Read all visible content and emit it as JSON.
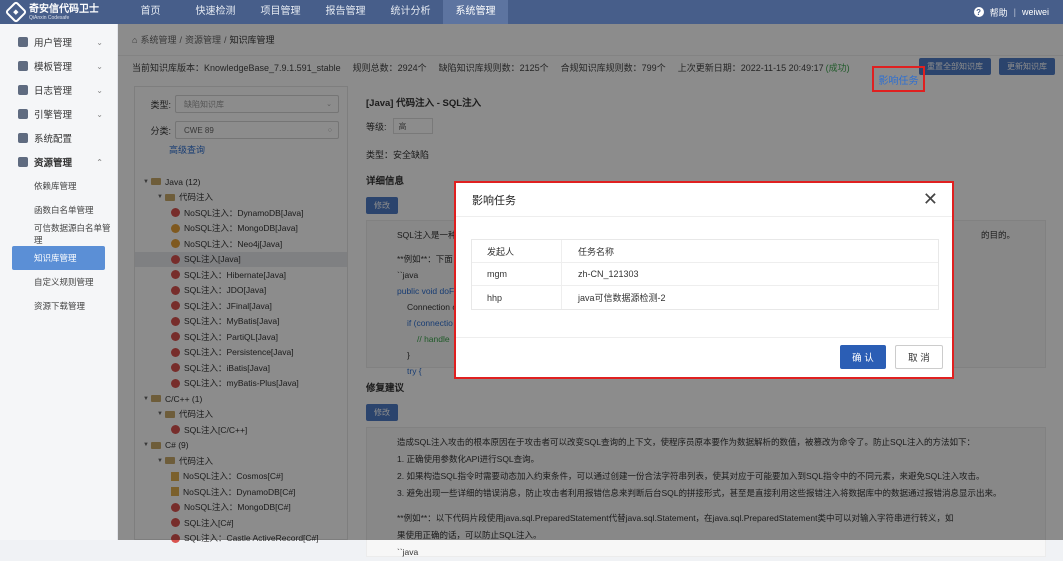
{
  "app": {
    "name": "奇安信代码卫士",
    "sub": "QiAnxin Codesafe"
  },
  "nav": [
    "首页",
    "快速检测",
    "项目管理",
    "报告管理",
    "统计分析",
    "系统管理"
  ],
  "nav_active": 5,
  "top_right": {
    "help": "帮助",
    "sep": "|",
    "user": "weiwei"
  },
  "sidebar": {
    "groups": [
      "用户管理",
      "模板管理",
      "日志管理",
      "引擎管理",
      "系统配置",
      "资源管理"
    ],
    "subs": [
      "依赖库管理",
      "函数白名单管理",
      "可信数据源白名单管理",
      "知识库管理",
      "自定义规则管理",
      "资源下载管理"
    ],
    "active_sub": 3
  },
  "breadcrumb": [
    "系统管理",
    "/",
    "资源管理",
    "/",
    "知识库管理"
  ],
  "info": {
    "version": "当前知识库版本：KnowledgeBase_7.9.1.591_stable",
    "total": "规则总数：2924个",
    "defect": "缺陷知识库规则数：2125个",
    "compliance": "合规知识库规则数：799个",
    "updated": "上次更新日期：2022-11-15 20:49:17",
    "status": "(成功)"
  },
  "buttons": {
    "reset": "重置全部知识库",
    "update": "更新知识库"
  },
  "filter": {
    "type_label": "类型:",
    "type_value": "缺陷知识库",
    "class_label": "分类:",
    "class_value": "CWE 89",
    "advanced": "高级查询"
  },
  "tree": [
    {
      "label": "Java (12)",
      "level": 0,
      "kind": "folder"
    },
    {
      "label": "代码注入",
      "level": 1,
      "kind": "folder"
    },
    {
      "label": "NoSQL注入：DynamoDB[Java]",
      "level": 2,
      "kind": "bad"
    },
    {
      "label": "NoSQL注入：MongoDB[Java]",
      "level": 2,
      "kind": "warn"
    },
    {
      "label": "NoSQL注入：Neo4j[Java]",
      "level": 2,
      "kind": "warn"
    },
    {
      "label": "SQL注入[Java]",
      "level": 2,
      "kind": "bad",
      "sel": true
    },
    {
      "label": "SQL注入：Hibernate[Java]",
      "level": 2,
      "kind": "bad"
    },
    {
      "label": "SQL注入：JDO[Java]",
      "level": 2,
      "kind": "bad"
    },
    {
      "label": "SQL注入：JFinal[Java]",
      "level": 2,
      "kind": "bad"
    },
    {
      "label": "SQL注入：MyBatis[Java]",
      "level": 2,
      "kind": "bad"
    },
    {
      "label": "SQL注入：PartiQL[Java]",
      "level": 2,
      "kind": "bad"
    },
    {
      "label": "SQL注入：Persistence[Java]",
      "level": 2,
      "kind": "bad"
    },
    {
      "label": "SQL注入：iBatis[Java]",
      "level": 2,
      "kind": "bad"
    },
    {
      "label": "SQL注入：myBatis-Plus[Java]",
      "level": 2,
      "kind": "bad"
    },
    {
      "label": "C/C++ (1)",
      "level": 0,
      "kind": "folder"
    },
    {
      "label": "代码注入",
      "level": 1,
      "kind": "folder"
    },
    {
      "label": "SQL注入[C/C++]",
      "level": 2,
      "kind": "bad"
    },
    {
      "label": "C# (9)",
      "level": 0,
      "kind": "folder"
    },
    {
      "label": "代码注入",
      "level": 1,
      "kind": "folder"
    },
    {
      "label": "NoSQL注入：Cosmos[C#]",
      "level": 2,
      "kind": "doc"
    },
    {
      "label": "NoSQL注入：DynamoDB[C#]",
      "level": 2,
      "kind": "doc"
    },
    {
      "label": "NoSQL注入：MongoDB[C#]",
      "level": 2,
      "kind": "bad"
    },
    {
      "label": "SQL注入[C#]",
      "level": 2,
      "kind": "bad"
    },
    {
      "label": "SQL注入：Castle ActiveRecord[C#]",
      "level": 2,
      "kind": "bad"
    }
  ],
  "detail": {
    "title": "[Java] 代码注入 - SQL注入",
    "level_label": "等级:",
    "level_value": "高",
    "type_text": "类型：安全缺陷",
    "section_detail": "详细信息",
    "edit": "修改",
    "code_lines": [
      "SQL注入是一种",
      "的目的。",
      "**例如**：下面",
      "``java",
      "public void doF",
      "Connection c",
      "if (connectio",
      "// handle",
      "}",
      "try {"
    ],
    "section_fix": "修复建议",
    "fix_lines": [
      "造成SQL注入攻击的根本原因在于攻击者可以改变SQL查询的上下文，使程序员原本要作为数据解析的数值，被篡改为命令了。防止SQL注入的方法如下：",
      "1. 正确使用参数化API进行SQL查询。",
      "2. 如果构造SQL指令时需要动态加入约束条件，可以通过创建一份合法字符串列表，使其对应于可能要加入到SQL指令中的不同元素，来避免SQL注入攻击。",
      "3. 避免出现一些详细的错误消息，防止攻击者利用报错信息来判断后台SQL的拼接形式，甚至是直接利用这些报错注入将数据库中的数据通过报错消息显示出来。",
      "**例如**：以下代码片段使用java.sql.PreparedStatement代替java.sql.Statement，在java.sql.PreparedStatement类中可以对输入字符串进行转义，如",
      "果使用正确的话，可以防止SQL注入。",
      "``java"
    ]
  },
  "influence_button": "影响任务",
  "modal": {
    "title": "影响任务",
    "columns": [
      "发起人",
      "任务名称"
    ],
    "rows": [
      {
        "user": "mgm",
        "task": "zh-CN_121303"
      },
      {
        "user": "hhp",
        "task": "java可信数据源检测-2"
      }
    ],
    "confirm": "确 认",
    "cancel": "取 消"
  }
}
